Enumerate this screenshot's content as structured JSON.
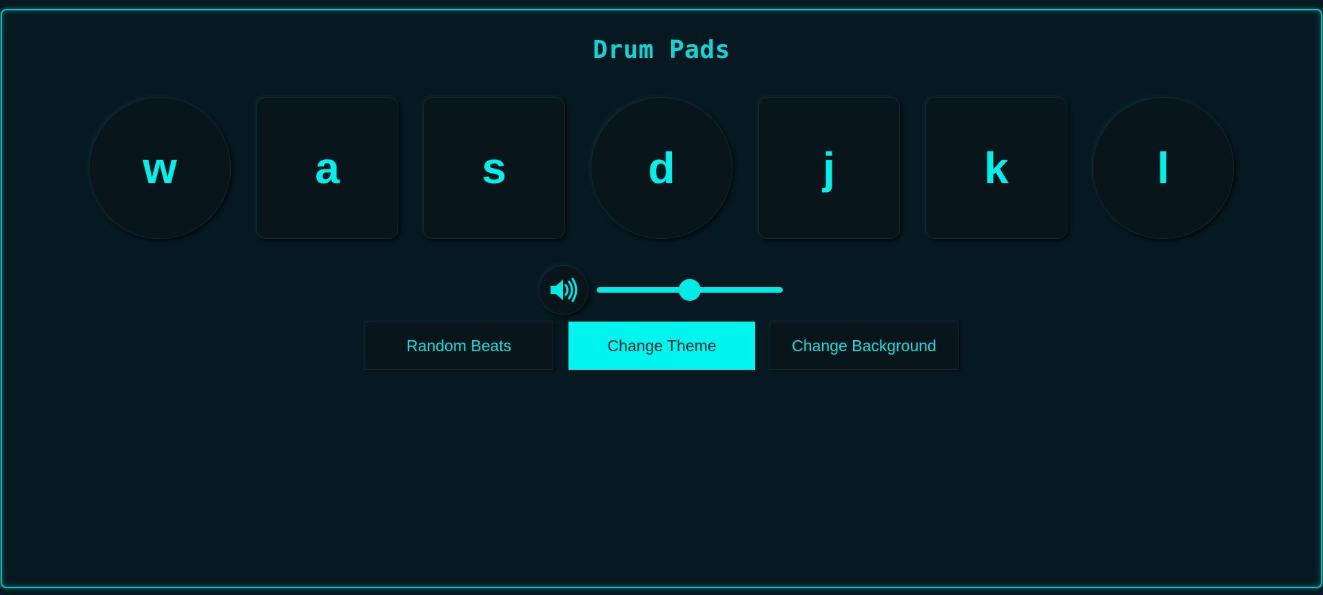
{
  "title": "Drum Pads",
  "pads": [
    {
      "key": "w",
      "shape": "circle"
    },
    {
      "key": "a",
      "shape": "square"
    },
    {
      "key": "s",
      "shape": "square"
    },
    {
      "key": "d",
      "shape": "circle"
    },
    {
      "key": "j",
      "shape": "square"
    },
    {
      "key": "k",
      "shape": "square"
    },
    {
      "key": "l",
      "shape": "circle"
    }
  ],
  "volume": {
    "icon": "speaker-volume-icon",
    "value": 0.5
  },
  "buttons": {
    "random_beats": "Random Beats",
    "change_theme": "Change Theme",
    "change_background": "Change Background",
    "active": "change_theme"
  },
  "colors": {
    "accent": "#00f0ea",
    "background": "#071920",
    "pad": "#08161c",
    "border_glow": "#0ec0c0"
  }
}
